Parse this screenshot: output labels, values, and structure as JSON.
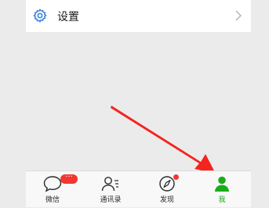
{
  "settings": {
    "label": "设置"
  },
  "tabbar": {
    "tabs": [
      {
        "label": "微信",
        "icon": "chat-bubble-icon",
        "badge": "···"
      },
      {
        "label": "通讯录",
        "icon": "contacts-icon"
      },
      {
        "label": "发现",
        "icon": "compass-icon",
        "dot": true
      },
      {
        "label": "我",
        "icon": "person-icon",
        "active": true
      }
    ]
  },
  "colors": {
    "accent": "#1aad19",
    "badge": "#f43530",
    "arrow": "#f5241f"
  }
}
